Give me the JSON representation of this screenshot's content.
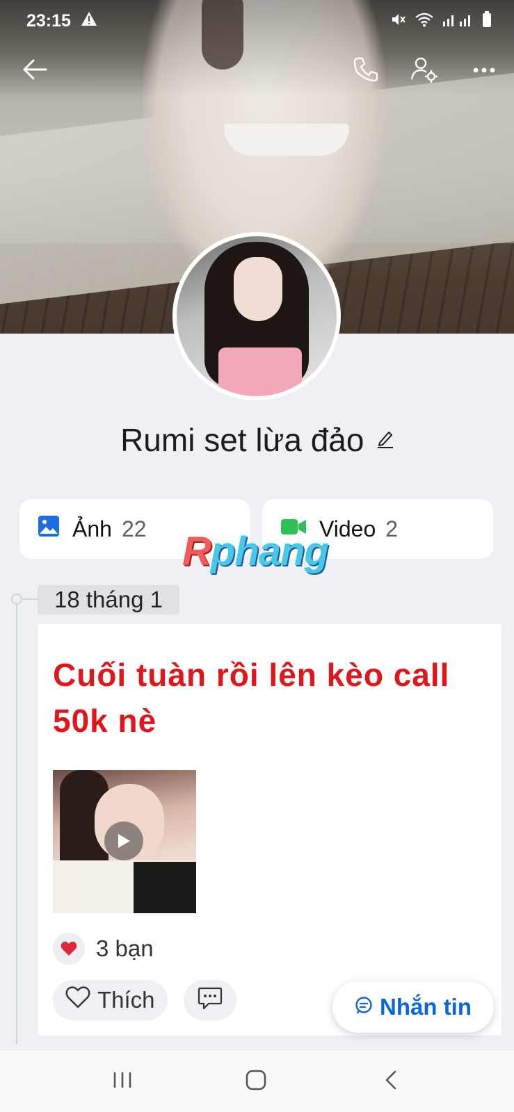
{
  "status_bar": {
    "time": "23:15"
  },
  "profile": {
    "name": "Rumi set lừa đảo"
  },
  "media": {
    "photos": {
      "label": "Ảnh",
      "count": "22"
    },
    "videos": {
      "label": "Video",
      "count": "2"
    }
  },
  "watermark": {
    "first": "R",
    "rest": "phang"
  },
  "timeline": {
    "date": "18 tháng 1",
    "post": {
      "text": "Cuối tuàn rồi lên kèo call 50k nè",
      "reaction_count": "3 bạn",
      "like_label": "Thích"
    }
  },
  "message_button": {
    "label": "Nhắn tin"
  },
  "colors": {
    "accent": "#0a67d9",
    "post_text": "#e0161b",
    "photo_icon": "#1b6fe0",
    "video_icon": "#2fbf5a",
    "heart": "#e0263a"
  },
  "icons": {
    "back": "arrow-left-icon",
    "call": "phone-icon",
    "settings": "user-settings-icon",
    "more": "more-dots-icon",
    "edit": "pencil-icon",
    "photos": "image-icon",
    "videos": "video-camera-icon",
    "play": "play-icon",
    "heart": "heart-icon",
    "like": "heart-outline-icon",
    "comment": "comment-icon",
    "message": "message-icon"
  }
}
